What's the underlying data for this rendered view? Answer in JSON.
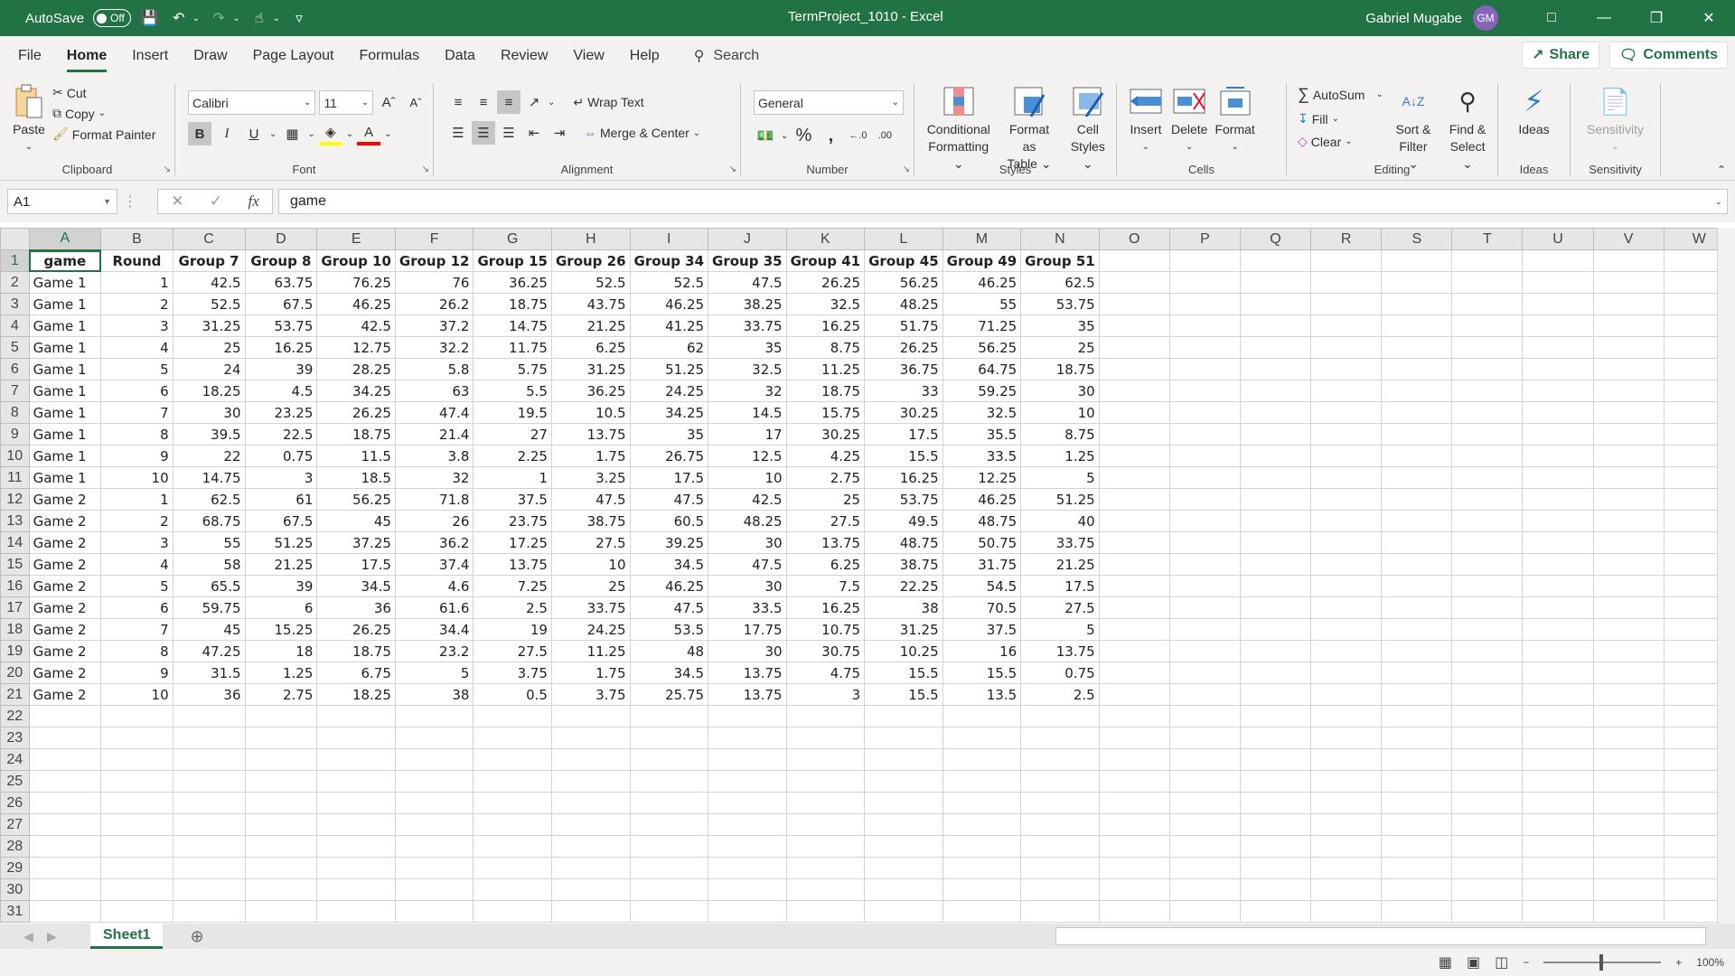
{
  "titlebar": {
    "autosave_label": "AutoSave",
    "autosave_state": "Off",
    "doc_title": "TermProject_1010  -  Excel",
    "user_name": "Gabriel Mugabe",
    "user_initials": "GM"
  },
  "tabs": [
    "File",
    "Home",
    "Insert",
    "Draw",
    "Page Layout",
    "Formulas",
    "Data",
    "Review",
    "View",
    "Help"
  ],
  "active_tab": "Home",
  "search_label": "Search",
  "share_label": "Share",
  "comments_label": "Comments",
  "ribbon": {
    "clipboard": {
      "paste": "Paste",
      "cut": "Cut",
      "copy": "Copy",
      "format_painter": "Format Painter",
      "label": "Clipboard"
    },
    "font": {
      "name": "Calibri",
      "size": "11",
      "label": "Font",
      "bold": "B",
      "italic": "I",
      "underline": "U"
    },
    "alignment": {
      "wrap_text": "Wrap Text",
      "merge_center": "Merge & Center",
      "label": "Alignment"
    },
    "number": {
      "format": "General",
      "label": "Number"
    },
    "styles": {
      "conditional": "Conditional",
      "conditional2": "Formatting",
      "format_as": "Format as",
      "format_as2": "Table",
      "cell": "Cell",
      "cell2": "Styles",
      "label": "Styles"
    },
    "cells": {
      "insert": "Insert",
      "delete": "Delete",
      "format": "Format",
      "label": "Cells"
    },
    "editing": {
      "autosum": "AutoSum",
      "fill": "Fill",
      "clear": "Clear",
      "sort": "Sort &",
      "sort2": "Filter",
      "find": "Find &",
      "find2": "Select",
      "label": "Editing"
    },
    "ideas": {
      "ideas": "Ideas",
      "label": "Ideas"
    },
    "sensitivity": {
      "sensitivity": "Sensitivity",
      "label": "Sensitivity"
    }
  },
  "formula_bar": {
    "name_box": "A1",
    "fx": "fx",
    "content": "game"
  },
  "sheet": {
    "columns": [
      "A",
      "B",
      "C",
      "D",
      "E",
      "F",
      "G",
      "H",
      "I",
      "J",
      "K",
      "L",
      "M",
      "N",
      "O",
      "P",
      "Q",
      "R",
      "S",
      "T",
      "U",
      "V",
      "W"
    ],
    "header_row": [
      "game",
      "Round",
      "Group 7",
      "Group 8",
      "Group 10",
      "Group 12",
      "Group 15",
      "Group 26",
      "Group 34",
      "Group 35",
      "Group 41",
      "Group 45",
      "Group 49",
      "Group 51"
    ],
    "rows": [
      [
        "Game 1",
        "1",
        "42.5",
        "63.75",
        "76.25",
        "76",
        "36.25",
        "52.5",
        "52.5",
        "47.5",
        "26.25",
        "56.25",
        "46.25",
        "62.5"
      ],
      [
        "Game 1",
        "2",
        "52.5",
        "67.5",
        "46.25",
        "26.2",
        "18.75",
        "43.75",
        "46.25",
        "38.25",
        "32.5",
        "48.25",
        "55",
        "53.75"
      ],
      [
        "Game 1",
        "3",
        "31.25",
        "53.75",
        "42.5",
        "37.2",
        "14.75",
        "21.25",
        "41.25",
        "33.75",
        "16.25",
        "51.75",
        "71.25",
        "35"
      ],
      [
        "Game 1",
        "4",
        "25",
        "16.25",
        "12.75",
        "32.2",
        "11.75",
        "6.25",
        "62",
        "35",
        "8.75",
        "26.25",
        "56.25",
        "25"
      ],
      [
        "Game 1",
        "5",
        "24",
        "39",
        "28.25",
        "5.8",
        "5.75",
        "31.25",
        "51.25",
        "32.5",
        "11.25",
        "36.75",
        "64.75",
        "18.75"
      ],
      [
        "Game 1",
        "6",
        "18.25",
        "4.5",
        "34.25",
        "63",
        "5.5",
        "36.25",
        "24.25",
        "32",
        "18.75",
        "33",
        "59.25",
        "30"
      ],
      [
        "Game 1",
        "7",
        "30",
        "23.25",
        "26.25",
        "47.4",
        "19.5",
        "10.5",
        "34.25",
        "14.5",
        "15.75",
        "30.25",
        "32.5",
        "10"
      ],
      [
        "Game 1",
        "8",
        "39.5",
        "22.5",
        "18.75",
        "21.4",
        "27",
        "13.75",
        "35",
        "17",
        "30.25",
        "17.5",
        "35.5",
        "8.75"
      ],
      [
        "Game 1",
        "9",
        "22",
        "0.75",
        "11.5",
        "3.8",
        "2.25",
        "1.75",
        "26.75",
        "12.5",
        "4.25",
        "15.5",
        "33.5",
        "1.25"
      ],
      [
        "Game 1",
        "10",
        "14.75",
        "3",
        "18.5",
        "32",
        "1",
        "3.25",
        "17.5",
        "10",
        "2.75",
        "16.25",
        "12.25",
        "5"
      ],
      [
        "Game 2",
        "1",
        "62.5",
        "61",
        "56.25",
        "71.8",
        "37.5",
        "47.5",
        "47.5",
        "42.5",
        "25",
        "53.75",
        "46.25",
        "51.25"
      ],
      [
        "Game 2",
        "2",
        "68.75",
        "67.5",
        "45",
        "26",
        "23.75",
        "38.75",
        "60.5",
        "48.25",
        "27.5",
        "49.5",
        "48.75",
        "40"
      ],
      [
        "Game 2",
        "3",
        "55",
        "51.25",
        "37.25",
        "36.2",
        "17.25",
        "27.5",
        "39.25",
        "30",
        "13.75",
        "48.75",
        "50.75",
        "33.75"
      ],
      [
        "Game 2",
        "4",
        "58",
        "21.25",
        "17.5",
        "37.4",
        "13.75",
        "10",
        "34.5",
        "47.5",
        "6.25",
        "38.75",
        "31.75",
        "21.25"
      ],
      [
        "Game 2",
        "5",
        "65.5",
        "39",
        "34.5",
        "4.6",
        "7.25",
        "25",
        "46.25",
        "30",
        "7.5",
        "22.25",
        "54.5",
        "17.5"
      ],
      [
        "Game 2",
        "6",
        "59.75",
        "6",
        "36",
        "61.6",
        "2.5",
        "33.75",
        "47.5",
        "33.5",
        "16.25",
        "38",
        "70.5",
        "27.5"
      ],
      [
        "Game 2",
        "7",
        "45",
        "15.25",
        "26.25",
        "34.4",
        "19",
        "24.25",
        "53.5",
        "17.75",
        "10.75",
        "31.25",
        "37.5",
        "5"
      ],
      [
        "Game 2",
        "8",
        "47.25",
        "18",
        "18.75",
        "23.2",
        "27.5",
        "11.25",
        "48",
        "30",
        "30.75",
        "10.25",
        "16",
        "13.75"
      ],
      [
        "Game 2",
        "9",
        "31.5",
        "1.25",
        "6.75",
        "5",
        "3.75",
        "1.75",
        "34.5",
        "13.75",
        "4.75",
        "15.5",
        "15.5",
        "0.75"
      ],
      [
        "Game 2",
        "10",
        "36",
        "2.75",
        "18.25",
        "38",
        "0.5",
        "3.75",
        "25.75",
        "13.75",
        "3",
        "15.5",
        "13.5",
        "2.5"
      ]
    ],
    "total_visible_rows": 31,
    "active_cell": "A1"
  },
  "sheet_tabs": [
    "Sheet1"
  ],
  "status": {
    "zoom": "100%"
  }
}
